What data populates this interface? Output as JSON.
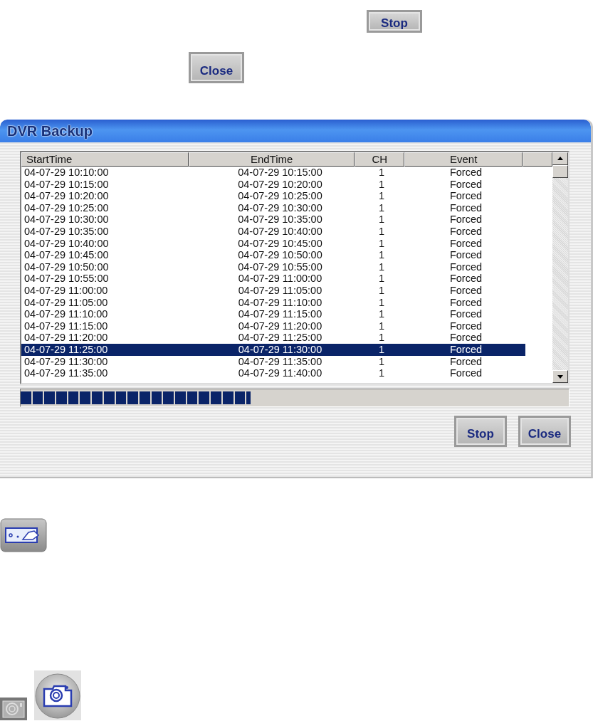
{
  "top_buttons": [
    {
      "label": "Stop"
    },
    {
      "label": "Close"
    }
  ],
  "window": {
    "title": "DVR Backup",
    "table": {
      "columns": [
        "StartTime",
        "EndTime",
        "CH",
        "Event"
      ],
      "rows": [
        {
          "start": "04-07-29 10:10:00",
          "end": "04-07-29 10:15:00",
          "ch": "1",
          "event": "Forced",
          "selected": false
        },
        {
          "start": "04-07-29 10:15:00",
          "end": "04-07-29 10:20:00",
          "ch": "1",
          "event": "Forced",
          "selected": false
        },
        {
          "start": "04-07-29 10:20:00",
          "end": "04-07-29 10:25:00",
          "ch": "1",
          "event": "Forced",
          "selected": false
        },
        {
          "start": "04-07-29 10:25:00",
          "end": "04-07-29 10:30:00",
          "ch": "1",
          "event": "Forced",
          "selected": false
        },
        {
          "start": "04-07-29 10:30:00",
          "end": "04-07-29 10:35:00",
          "ch": "1",
          "event": "Forced",
          "selected": false
        },
        {
          "start": "04-07-29 10:35:00",
          "end": "04-07-29 10:40:00",
          "ch": "1",
          "event": "Forced",
          "selected": false
        },
        {
          "start": "04-07-29 10:40:00",
          "end": "04-07-29 10:45:00",
          "ch": "1",
          "event": "Forced",
          "selected": false
        },
        {
          "start": "04-07-29 10:45:00",
          "end": "04-07-29 10:50:00",
          "ch": "1",
          "event": "Forced",
          "selected": false
        },
        {
          "start": "04-07-29 10:50:00",
          "end": "04-07-29 10:55:00",
          "ch": "1",
          "event": "Forced",
          "selected": false
        },
        {
          "start": "04-07-29 10:55:00",
          "end": "04-07-29 11:00:00",
          "ch": "1",
          "event": "Forced",
          "selected": false
        },
        {
          "start": "04-07-29 11:00:00",
          "end": "04-07-29 11:05:00",
          "ch": "1",
          "event": "Forced",
          "selected": false
        },
        {
          "start": "04-07-29 11:05:00",
          "end": "04-07-29 11:10:00",
          "ch": "1",
          "event": "Forced",
          "selected": false
        },
        {
          "start": "04-07-29 11:10:00",
          "end": "04-07-29 11:15:00",
          "ch": "1",
          "event": "Forced",
          "selected": false
        },
        {
          "start": "04-07-29 11:15:00",
          "end": "04-07-29 11:20:00",
          "ch": "1",
          "event": "Forced",
          "selected": false
        },
        {
          "start": "04-07-29 11:20:00",
          "end": "04-07-29 11:25:00",
          "ch": "1",
          "event": "Forced",
          "selected": false
        },
        {
          "start": "04-07-29 11:25:00",
          "end": "04-07-29 11:30:00",
          "ch": "1",
          "event": "Forced",
          "selected": true
        },
        {
          "start": "04-07-29 11:30:00",
          "end": "04-07-29 11:35:00",
          "ch": "1",
          "event": "Forced",
          "selected": false
        },
        {
          "start": "04-07-29 11:35:00",
          "end": "04-07-29 11:40:00",
          "ch": "1",
          "event": "Forced",
          "selected": false
        }
      ]
    },
    "progress": {
      "level": 0.42
    },
    "buttons": [
      {
        "label": "Stop"
      },
      {
        "label": "Close"
      }
    ]
  }
}
